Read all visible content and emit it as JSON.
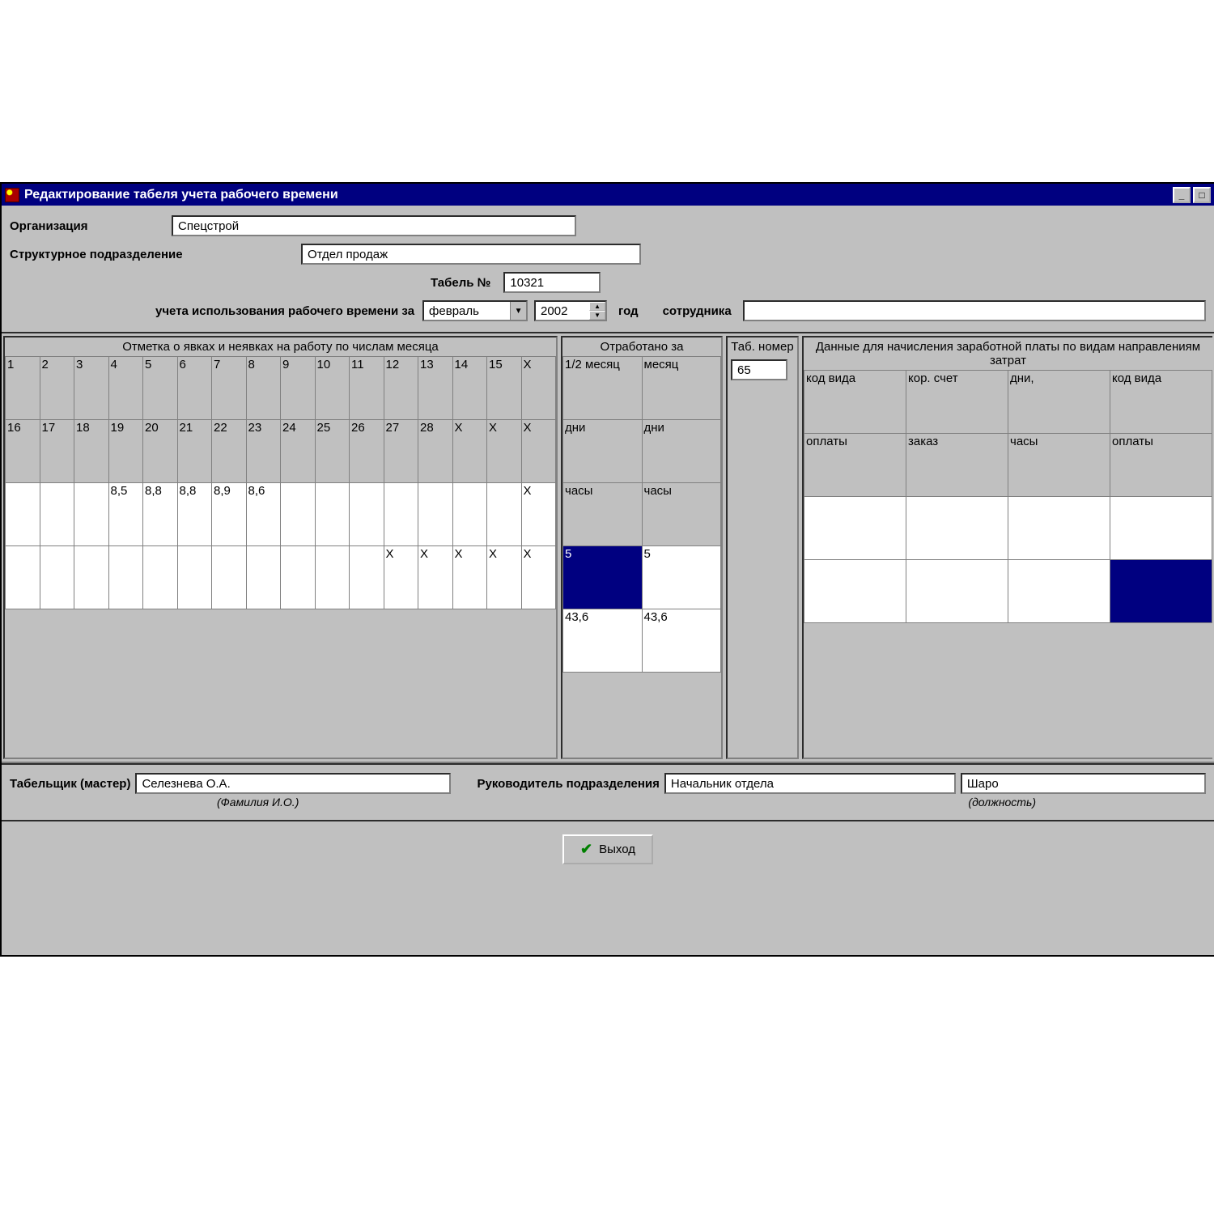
{
  "window": {
    "title": "Редактирование табеля учета рабочего времени"
  },
  "form": {
    "org_label": "Организация",
    "org_value": "Спецстрой",
    "dept_label": "Структурное подразделение",
    "dept_value": "Отдел продаж",
    "tabel_no_label": "Табель №",
    "tabel_no_value": "10321",
    "period_label_pre": "учета использования рабочего времени за",
    "month_value": "февраль",
    "year_value": "2002",
    "year_label": "год",
    "employee_label": "сотрудника",
    "employee_value": ""
  },
  "sections": {
    "attendance": "Отметка о явках и неявках на работу по числам месяца",
    "worked": "Отработано за",
    "tabnum": "Таб. номер",
    "tabnum_value": "65",
    "payroll": "Данные для начисления заработной платы по видам направлениям затрат"
  },
  "attendance": {
    "row1": [
      "1",
      "2",
      "3",
      "4",
      "5",
      "6",
      "7",
      "8",
      "9",
      "10",
      "11",
      "12",
      "13",
      "14",
      "15",
      "X"
    ],
    "row2": [
      "16",
      "17",
      "18",
      "19",
      "20",
      "21",
      "22",
      "23",
      "24",
      "25",
      "26",
      "27",
      "28",
      "X",
      "X",
      "X"
    ],
    "data1": [
      "",
      "",
      "",
      "8,5",
      "8,8",
      "8,8",
      "8,9",
      "8,6",
      "",
      "",
      "",
      "",
      "",
      "",
      "",
      "X"
    ],
    "data2": [
      "",
      "",
      "",
      "",
      "",
      "",
      "",
      "",
      "",
      "",
      "",
      "X",
      "X",
      "X",
      "X",
      "X"
    ]
  },
  "worked": {
    "h1": "1/2 месяц",
    "h2": "месяц",
    "h3": "дни",
    "h4": "дни",
    "h5": "часы",
    "h6": "часы",
    "v1a": "5",
    "v1b": "5",
    "v2a": "43,6",
    "v2b": "43,6"
  },
  "payroll": {
    "r1c1": "код вида",
    "r1c2": "кор. счет",
    "r1c3": "дни,",
    "r1c4": "код вида",
    "r2c1": "оплаты",
    "r2c2": "заказ",
    "r2c3": "часы",
    "r2c4": "оплаты"
  },
  "footer": {
    "keeper_label": "Табельщик (мастер)",
    "keeper_value": "Селезнева О.А.",
    "keeper_hint": "(Фамилия И.О.)",
    "head_label": "Руководитель подразделения",
    "head_pos_value": "Начальник отдела",
    "head_name_value": "Шаро",
    "head_hint": "(должность)"
  },
  "buttons": {
    "exit": "Выход"
  }
}
